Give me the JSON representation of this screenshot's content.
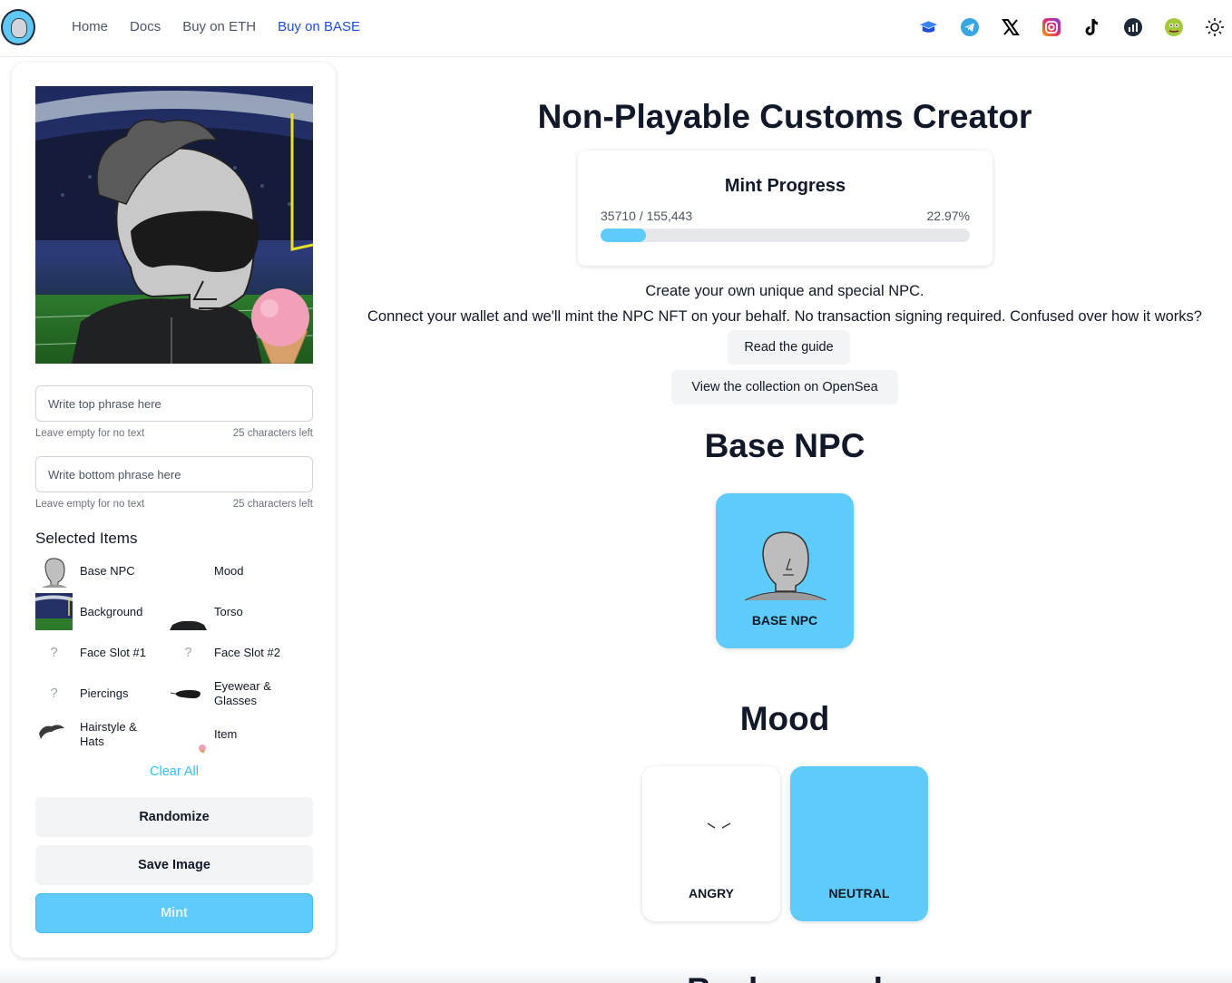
{
  "nav": {
    "links": [
      {
        "label": "Home",
        "active": false
      },
      {
        "label": "Docs",
        "active": false
      },
      {
        "label": "Buy on ETH",
        "active": false
      },
      {
        "label": "Buy on BASE",
        "active": true
      }
    ],
    "socials": [
      "book-icon",
      "telegram-icon",
      "x-icon",
      "instagram-icon",
      "tiktok-icon",
      "chart-icon",
      "pepe-icon",
      "sun-icon"
    ]
  },
  "editor": {
    "top_phrase": {
      "placeholder": "Write top phrase here",
      "hint": "Leave empty for no text",
      "remaining": "25 characters left"
    },
    "bottom_phrase": {
      "placeholder": "Write bottom phrase here",
      "hint": "Leave empty for no text",
      "remaining": "25 characters left"
    },
    "selected_title": "Selected Items",
    "items": [
      {
        "label": "Base NPC"
      },
      {
        "label": "Mood"
      },
      {
        "label": "Background"
      },
      {
        "label": "Torso"
      },
      {
        "label": "Face Slot #1",
        "placeholder": "?"
      },
      {
        "label": "Face Slot #2",
        "placeholder": "?"
      },
      {
        "label": "Piercings",
        "placeholder": "?"
      },
      {
        "label": "Eyewear & Glasses"
      },
      {
        "label": "Hairstyle & Hats"
      },
      {
        "label": "Item"
      }
    ],
    "clear_label": "Clear All",
    "randomize_label": "Randomize",
    "save_label": "Save Image",
    "mint_label": "Mint"
  },
  "main": {
    "title": "Non-Playable Customs Creator",
    "mint_progress": {
      "title": "Mint Progress",
      "count": "35710 / 155,443",
      "percent_text": "22.97%",
      "percent": 12.3
    },
    "desc1": "Create your own unique and special NPC.",
    "desc2": "Connect your wallet and we'll mint the NPC NFT on your behalf. No transaction signing required. Confused over how it works?",
    "guide_label": "Read the guide",
    "opensea_label": "View the collection on OpenSea",
    "base_title": "Base NPC",
    "base_card_label": "BASE NPC",
    "mood_title": "Mood",
    "mood_cards": [
      {
        "label": "ANGRY"
      },
      {
        "label": "NEUTRAL"
      }
    ],
    "next_title": "Background"
  },
  "colors": {
    "accent": "#5ecbfb",
    "link_active": "#1d4ed8",
    "clear": "#38bdf8"
  }
}
